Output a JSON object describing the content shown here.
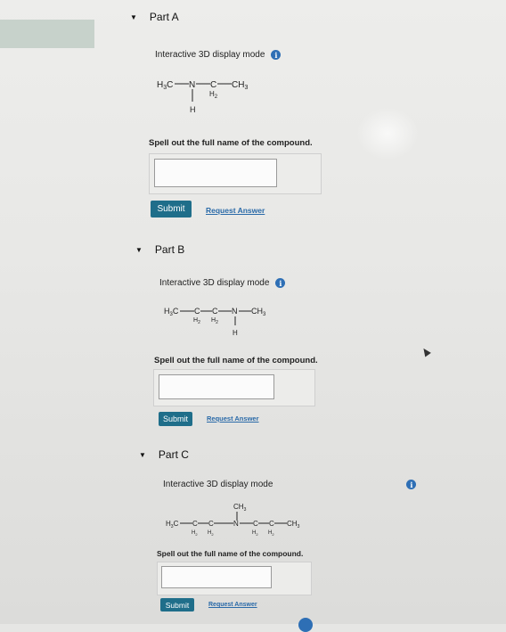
{
  "parts": [
    {
      "header": "Part A",
      "mode_label": "Interactive 3D display mode",
      "info_icon": "i",
      "molecule": {
        "left": "H3C—N—C—CH3",
        "ch2_label": "H2",
        "h_label": "H"
      },
      "prompt": "Spell out the full name of the compound.",
      "input_value": "",
      "submit_label": "Submit",
      "request_label": "Request Answer"
    },
    {
      "header": "Part B",
      "mode_label": "Interactive 3D display mode",
      "info_icon": "i",
      "molecule": {
        "main": "H3C—C—C—N—CH3",
        "h2_a": "H2",
        "h2_b": "H2",
        "h_label": "H"
      },
      "prompt": "Spell out the full name of the compound.",
      "input_value": "",
      "submit_label": "Submit",
      "request_label": "Request Answer"
    },
    {
      "header": "Part C",
      "mode_label": "Interactive 3D display mode",
      "info_icon": "i",
      "molecule": {
        "main": "H3C—C—C—N—C—C—CH3",
        "top_ch3": "CH3",
        "h2_a": "H2",
        "h2_b": "H2",
        "h2_c": "H2",
        "h2_d": "H2"
      },
      "prompt": "Spell out the full name of the compound.",
      "input_value": "",
      "submit_label": "Submit",
      "request_label": "Request Answer"
    }
  ]
}
